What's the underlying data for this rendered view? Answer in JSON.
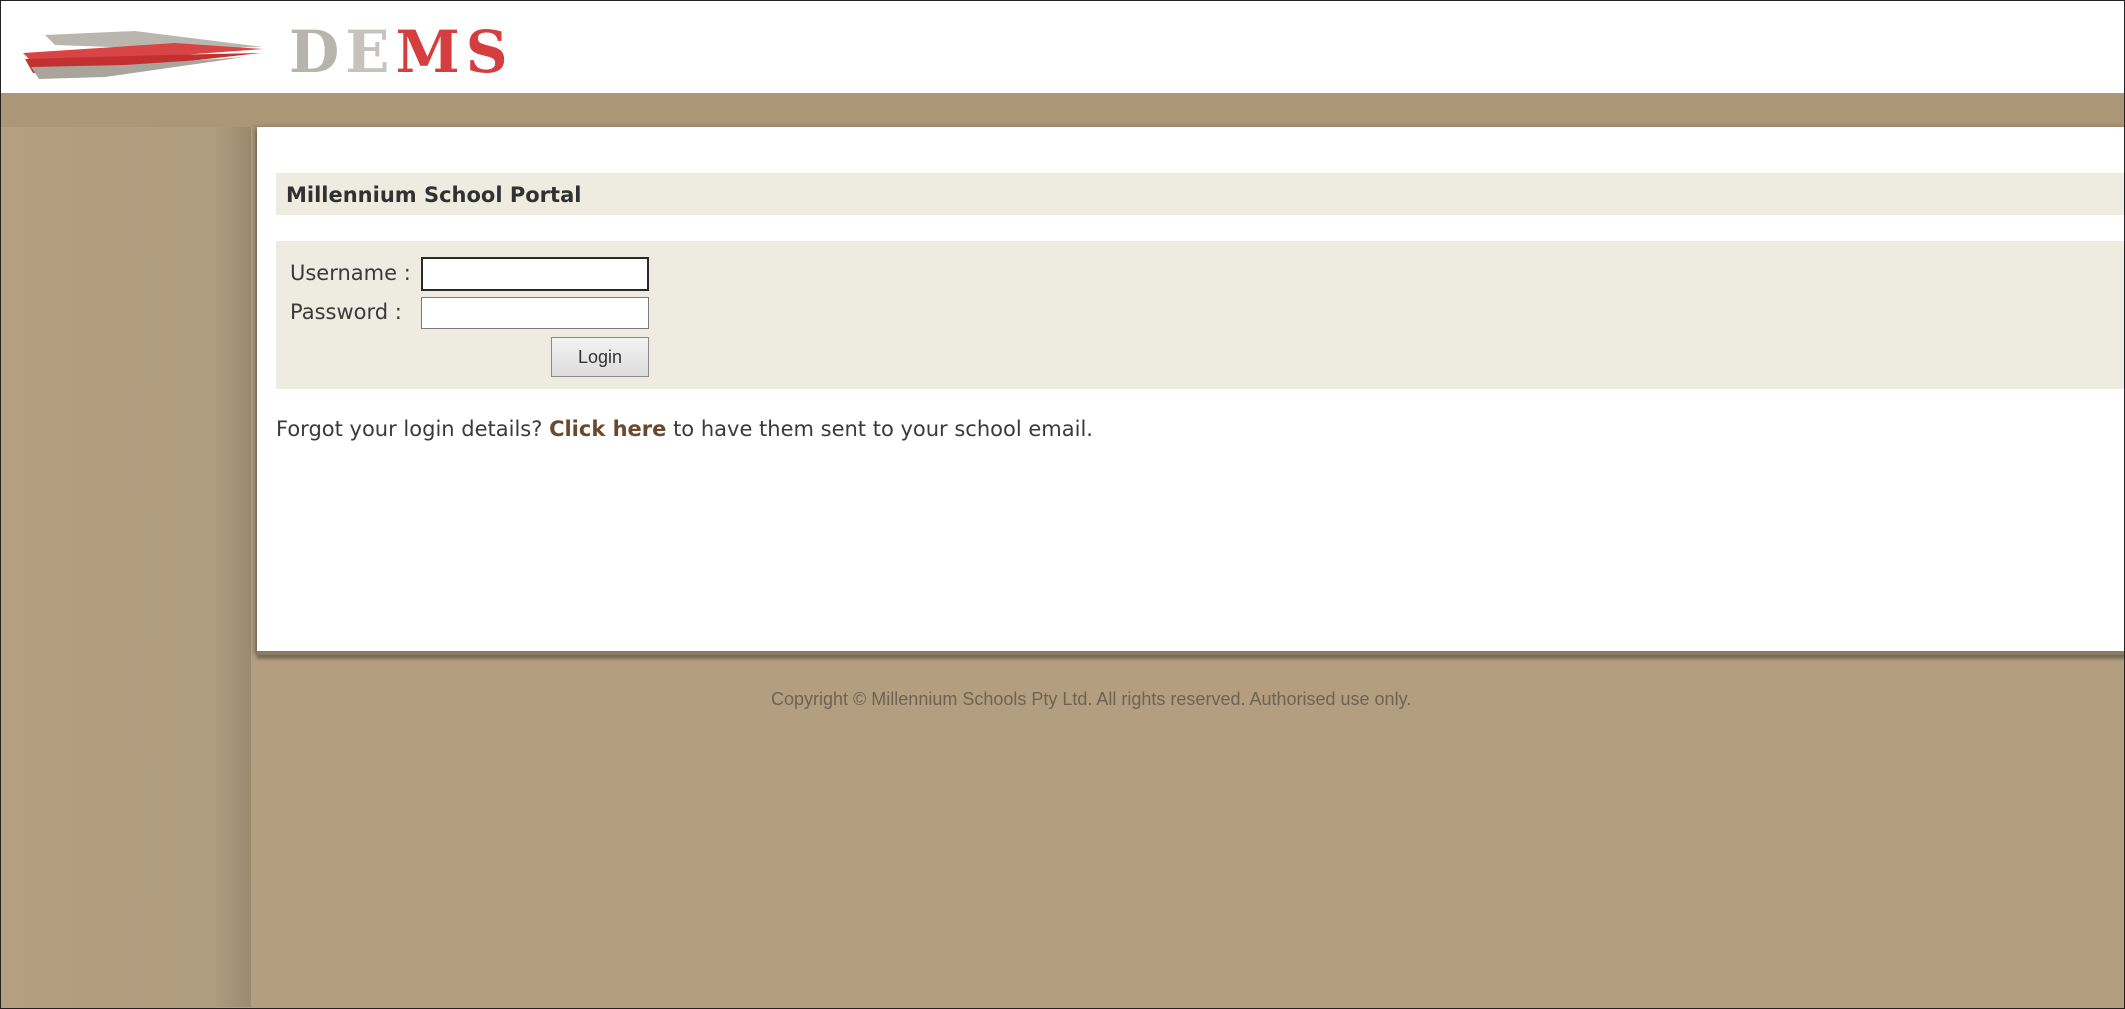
{
  "logo": {
    "text_parts": [
      "D",
      "E",
      "M",
      "S"
    ],
    "accent_color": "#d43e3e"
  },
  "portal": {
    "title": "Millennium School Portal"
  },
  "login": {
    "username_label": "Username :",
    "password_label": "Password :",
    "username_value": "",
    "password_value": "",
    "login_button": "Login"
  },
  "forgot": {
    "prefix": "Forgot your login details?",
    "link": "Click here",
    "suffix": "to have them sent to your school email."
  },
  "footer": {
    "copyright": "Copyright © Millennium Schools Pty Ltd. All rights reserved. Authorised use only."
  },
  "colors": {
    "background": "#b39f80",
    "panel": "#eeece0",
    "link": "#6a4a2e"
  }
}
